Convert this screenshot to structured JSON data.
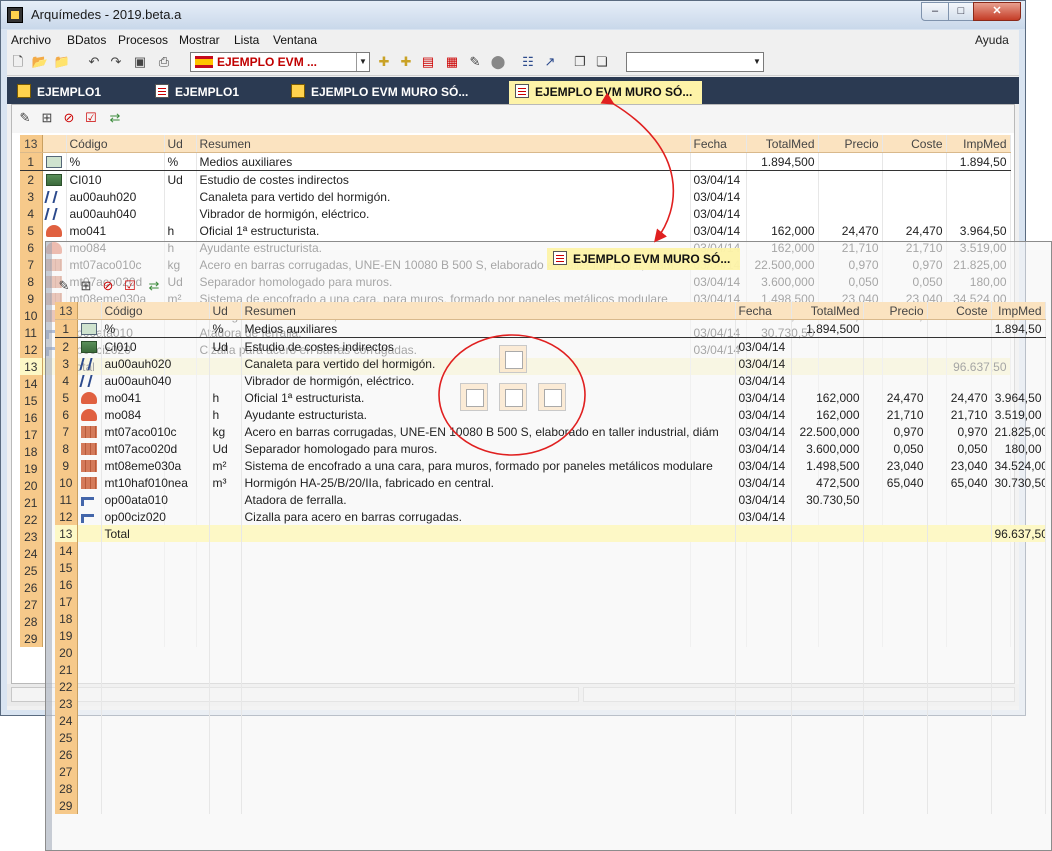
{
  "window": {
    "title": "Arquímedes - 2019.beta.a"
  },
  "menu": [
    "Archivo",
    "BDatos",
    "Procesos",
    "Mostrar",
    "Lista",
    "Ventana"
  ],
  "help_label": "Ayuda",
  "toolbar": {
    "project_combo": "EJEMPLO EVM ...",
    "search_combo": ""
  },
  "tabs": [
    {
      "label": "EJEMPLO1",
      "icon": "plus-icon"
    },
    {
      "label": "EJEMPLO1",
      "icon": "document-icon"
    },
    {
      "label": "EJEMPLO EVM MURO SÓ...",
      "icon": "plus-icon"
    },
    {
      "label": "EJEMPLO EVM MURO SÓ...",
      "icon": "document-icon",
      "active": true
    }
  ],
  "ghost_tab_label": "EJEMPLO EVM MURO SÓ...",
  "grid": {
    "corner": "13",
    "columns": [
      "Código",
      "Ud",
      "Resumen",
      "Fecha",
      "TotalMed",
      "Precio",
      "Coste",
      "ImpMed"
    ],
    "rows": [
      {
        "n": "1",
        "icon": "percent-icon",
        "codigo": "%",
        "ud": "%",
        "resumen": "Medios auxiliares",
        "fecha": "",
        "totalmed": "1.894,500",
        "precio": "",
        "coste": "",
        "impmed": "1.894,50"
      },
      {
        "n": "2",
        "icon": "indirect-cost-icon",
        "codigo": "CI010",
        "ud": "Ud",
        "resumen": "Estudio de costes indirectos",
        "fecha": "03/04/14",
        "totalmed": "",
        "precio": "",
        "coste": "",
        "impmed": ""
      },
      {
        "n": "3",
        "icon": "machinery-icon",
        "codigo": "au00auh020",
        "ud": "",
        "resumen": "Canaleta para vertido del hormigón.",
        "fecha": "03/04/14",
        "totalmed": "",
        "precio": "",
        "coste": "",
        "impmed": ""
      },
      {
        "n": "4",
        "icon": "machinery-icon",
        "codigo": "au00auh040",
        "ud": "",
        "resumen": "Vibrador de hormigón, eléctrico.",
        "fecha": "03/04/14",
        "totalmed": "",
        "precio": "",
        "coste": "",
        "impmed": ""
      },
      {
        "n": "5",
        "icon": "labour-icon",
        "codigo": "mo041",
        "ud": "h",
        "resumen": "Oficial 1ª estructurista.",
        "fecha": "03/04/14",
        "totalmed": "162,000",
        "precio": "24,470",
        "coste": "24,470",
        "impmed": "3.964,50"
      },
      {
        "n": "6",
        "icon": "labour-icon",
        "codigo": "mo084",
        "ud": "h",
        "resumen": "Ayudante estructurista.",
        "fecha": "03/04/14",
        "totalmed": "162,000",
        "precio": "21,710",
        "coste": "21,710",
        "impmed": "3.519,00"
      },
      {
        "n": "7",
        "icon": "material-icon",
        "codigo": "mt07aco010c",
        "ud": "kg",
        "resumen": "Acero en barras corrugadas, UNE-EN 10080 B 500 S, elaborado en taller industrial, diám",
        "fecha": "03/04/14",
        "totalmed": "22.500,000",
        "precio": "0,970",
        "coste": "0,970",
        "impmed": "21.825,00"
      },
      {
        "n": "8",
        "icon": "material-icon",
        "codigo": "mt07aco020d",
        "ud": "Ud",
        "resumen": "Separador homologado para muros.",
        "fecha": "03/04/14",
        "totalmed": "3.600,000",
        "precio": "0,050",
        "coste": "0,050",
        "impmed": "180,00"
      },
      {
        "n": "9",
        "icon": "material-icon",
        "codigo": "mt08eme030a",
        "ud": "m²",
        "resumen": "Sistema de encofrado a una cara, para muros, formado por paneles metálicos modulare",
        "fecha": "03/04/14",
        "totalmed": "1.498,500",
        "precio": "23,040",
        "coste": "23,040",
        "impmed": "34.524,00"
      },
      {
        "n": "10",
        "icon": "material-icon",
        "codigo": "mt10haf010nea",
        "ud": "m³",
        "resumen": "Hormigón HA-25/B/20/IIa, fabricado en central.",
        "fecha": "03/04/14",
        "totalmed": "472,500",
        "precio": "65,040",
        "coste": "65,040",
        "impmed": "30.730,50"
      },
      {
        "n": "11",
        "icon": "tool-icon",
        "codigo": "op00ata010",
        "ud": "",
        "resumen": "Atadora de ferralla.",
        "fecha": "03/04/14",
        "totalmed": "30.730,50",
        "precio": "",
        "coste": "",
        "impmed": ""
      },
      {
        "n": "12",
        "icon": "tool-icon",
        "codigo": "op00ciz020",
        "ud": "",
        "resumen": "Cizalla para acero en barras corrugadas.",
        "fecha": "03/04/14",
        "totalmed": "",
        "precio": "",
        "coste": "",
        "impmed": ""
      }
    ],
    "total_row": {
      "n": "13",
      "label": "Total",
      "impmed": "96.637,50"
    },
    "empty_rows_back": [
      "14",
      "15",
      "16",
      "17",
      "18",
      "19",
      "20",
      "21",
      "22",
      "23",
      "24",
      "25",
      "26",
      "27",
      "28",
      "29"
    ],
    "empty_rows_ghost": [
      "14",
      "15",
      "16",
      "17",
      "18",
      "19",
      "20",
      "21",
      "22",
      "23",
      "24",
      "25",
      "26",
      "27",
      "28",
      "29"
    ]
  }
}
